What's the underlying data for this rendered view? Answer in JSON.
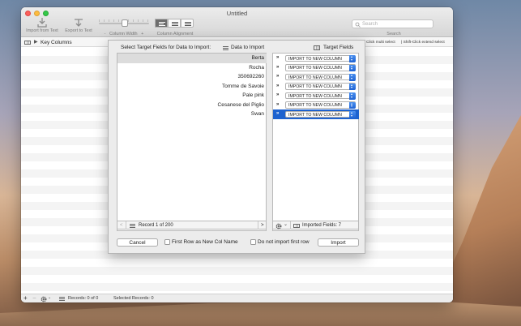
{
  "window": {
    "title": "Untitled"
  },
  "toolbar": {
    "import_label": "Import from Text",
    "export_label": "Export to Text",
    "column_width_label": "Column Width",
    "minus": "-",
    "plus": "+",
    "alignment_label": "Column Alignment",
    "search_placeholder": "Search",
    "search_label": "Search"
  },
  "subbar": {
    "key_columns": "Key Columns",
    "hint_multi": "Click multi select",
    "hint_extend": "| Shift-Click extend select"
  },
  "sheet": {
    "prompt": "Select Target Fields for Data to Import:",
    "data_header": "Data to Import",
    "target_header": "Target Fields",
    "source_rows": [
      "Berta",
      "Rocha",
      "350692260",
      "Tomme de Savoie",
      "Pale pink",
      "Cesanese del Piglio",
      "Swan"
    ],
    "target_value": "IMPORT TO NEW COLUMN",
    "arrow": "»",
    "record_label": "Record 1 of 200",
    "prev": "<",
    "next": ">",
    "imported_fields": "Imported Fields: 7",
    "cancel": "Cancel",
    "first_row_label": "First Row as New Col Name",
    "no_first_row_label": "Do not import first row",
    "import": "Import"
  },
  "statusbar": {
    "plus": "+",
    "minus": "−",
    "records": "Records: 0 of 0",
    "selected": "Selected Records: 0"
  },
  "colors": {
    "accent": "#1d62cf",
    "selected_row": "#dcdcdc"
  }
}
